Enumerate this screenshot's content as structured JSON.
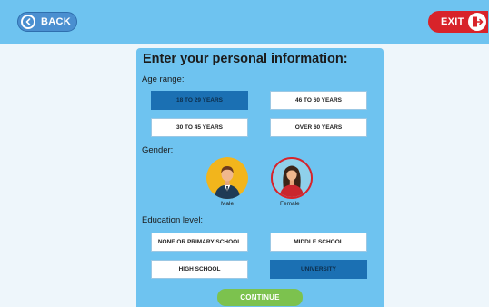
{
  "header": {
    "back_label": "BACK",
    "exit_label": "EXIT"
  },
  "form": {
    "title": "Enter your personal information:",
    "age": {
      "label": "Age range:",
      "options": [
        "18 TO 29 YEARS",
        "46 TO 60 YEARS",
        "30 TO 45 YEARS",
        "OVER 60 YEARS"
      ],
      "selected": "18 TO 29 YEARS"
    },
    "gender": {
      "label": "Gender:",
      "male_label": "Male",
      "female_label": "Female",
      "selected": "Female"
    },
    "education": {
      "label": "Education level:",
      "options": [
        "NONE OR PRIMARY SCHOOL",
        "MIDDLE SCHOOL",
        "HIGH SCHOOL",
        "UNIVERSITY"
      ],
      "selected": "UNIVERSITY"
    },
    "continue_label": "CONTINUE"
  },
  "colors": {
    "topbar": "#6ec3f0",
    "panel": "#6ec3f0",
    "selected": "#1b70b3",
    "exit": "#d8232a",
    "continue": "#7cc24e",
    "female_ring": "#d8232a",
    "male_bg": "#f2b51c"
  }
}
